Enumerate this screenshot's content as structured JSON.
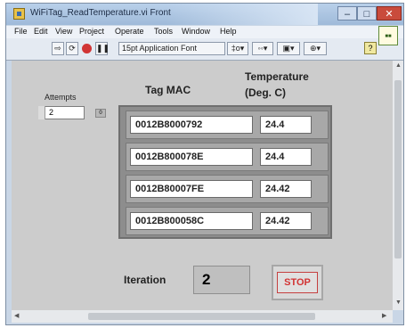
{
  "window": {
    "title": "WiFiTag_ReadTemperature.vi Front Panel *",
    "minimize": "–",
    "maximize": "□",
    "close": "✕"
  },
  "menu": [
    "File",
    "Edit",
    "View",
    "Project",
    "Operate",
    "Tools",
    "Window",
    "Help"
  ],
  "toolbar": {
    "font_select": "15pt Application Font",
    "align": "‡o▾",
    "distribute": "◦◦▾",
    "resize": "▣▾",
    "reorder": "⊕▾",
    "help": "?"
  },
  "front_panel": {
    "attempts_label": "Attempts",
    "attempts_value": "2",
    "array_index": "0",
    "col_tag_mac": "Tag MAC",
    "col_temperature_line1": "Temperature",
    "col_temperature_line2": "(Deg. C)",
    "rows": [
      {
        "mac": "0012B8000792",
        "temp": "24.4"
      },
      {
        "mac": "0012B800078E",
        "temp": "24.4"
      },
      {
        "mac": "0012B80007FE",
        "temp": "24.42"
      },
      {
        "mac": "0012B800058C",
        "temp": "24.42"
      }
    ],
    "iteration_label": "Iteration",
    "iteration_value": "2",
    "stop_label": "STOP"
  }
}
